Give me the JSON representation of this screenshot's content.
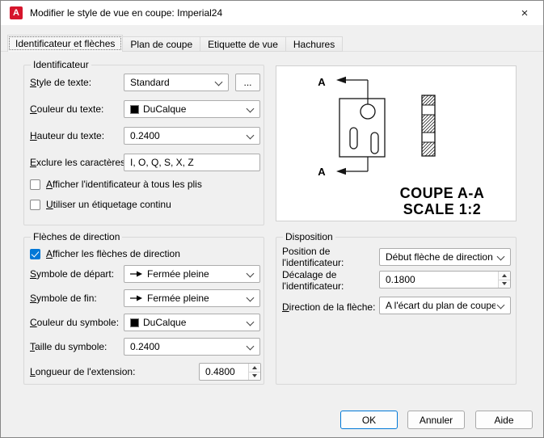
{
  "window": {
    "title": "Modifier le style de vue en coupe: Imperial24"
  },
  "icons": {
    "app_logo": "A",
    "close": "×",
    "browse": "..."
  },
  "tabs": [
    {
      "label": "Identificateur et flèches",
      "selected": true
    },
    {
      "label": "Plan de coupe",
      "selected": false
    },
    {
      "label": "Etiquette de vue",
      "selected": false
    },
    {
      "label": "Hachures",
      "selected": false
    }
  ],
  "identifier": {
    "title": "Identificateur",
    "text_style": {
      "label": "Style de texte:",
      "value": "Standard"
    },
    "text_color": {
      "label": "Couleur du texte:",
      "value": "DuCalque"
    },
    "text_height": {
      "label": "Hauteur du texte:",
      "value": "0.2400"
    },
    "exclude_chars": {
      "label": "Exclure les caractères:",
      "value": "I, O, Q, S, X, Z"
    },
    "show_at_folds": {
      "label": "Afficher l'identificateur à tous les plis",
      "checked": false
    },
    "continuous_labeling": {
      "label": "Utiliser un étiquetage continu",
      "checked": false
    }
  },
  "direction_arrows": {
    "title": "Flèches de direction",
    "show_arrows": {
      "label": "Afficher les flèches de direction",
      "checked": true
    },
    "start_symbol": {
      "label": "Symbole de départ:",
      "value": "Fermée pleine"
    },
    "end_symbol": {
      "label": "Symbole de fin:",
      "value": "Fermée pleine"
    },
    "symbol_color": {
      "label": "Couleur du symbole:",
      "value": "DuCalque"
    },
    "symbol_size": {
      "label": "Taille du symbole:",
      "value": "0.2400"
    },
    "extension_length": {
      "label": "Longueur de l'extension:",
      "value": "0.4800"
    }
  },
  "preview": {
    "section_label_top": "A",
    "section_label_bottom": "A",
    "caption_line1": "COUPE A-A",
    "caption_line2": "SCALE 1:2"
  },
  "disposition": {
    "title": "Disposition",
    "identifier_position": {
      "label": "Position de l'identificateur:",
      "value": "Début flèche de direction"
    },
    "identifier_offset": {
      "label": "Décalage de l'identificateur:",
      "value": "0.1800"
    },
    "arrow_direction": {
      "label": "Direction de la flèche:",
      "value": "A l'écart du plan de coupe"
    }
  },
  "buttons": {
    "ok": "OK",
    "cancel": "Annuler",
    "help": "Aide"
  },
  "colors": {
    "accent": "#0078d7",
    "swatch_ducalque": "#000000"
  }
}
